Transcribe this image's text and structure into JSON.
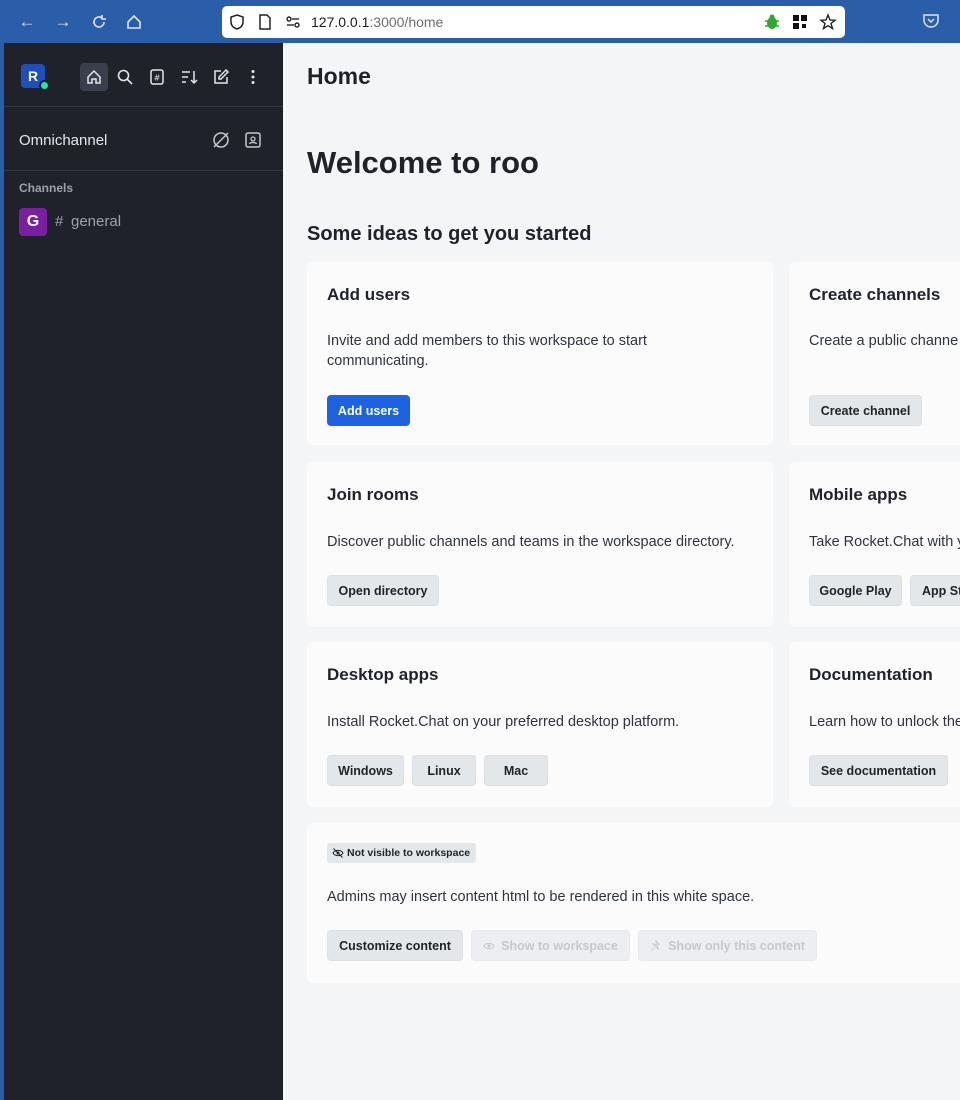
{
  "browser": {
    "url_host": "127.0.0.1",
    "url_path": ":3000/home"
  },
  "sidebar": {
    "avatar_initial": "R",
    "omnichannel_label": "Omnichannel",
    "channels_heading": "Channels",
    "channels": [
      {
        "initial": "G",
        "hash": "#",
        "name": "general"
      }
    ]
  },
  "main": {
    "page_title": "Home",
    "welcome": "Welcome to roo",
    "subheading": "Some ideas to get you started",
    "cards": {
      "add_users": {
        "title": "Add users",
        "text": "Invite and add members to this workspace to start communicating.",
        "button": "Add users"
      },
      "create_channels": {
        "title": "Create channels",
        "text": "Create a public channe",
        "button": "Create channel"
      },
      "join_rooms": {
        "title": "Join rooms",
        "text": "Discover public channels and teams in the workspace directory.",
        "button": "Open directory"
      },
      "mobile_apps": {
        "title": "Mobile apps",
        "text": "Take Rocket.Chat with y",
        "buttons": [
          "Google Play",
          "App St"
        ]
      },
      "desktop_apps": {
        "title": "Desktop apps",
        "text": "Install Rocket.Chat on your preferred desktop platform.",
        "buttons": [
          "Windows",
          "Linux",
          "Mac"
        ]
      },
      "documentation": {
        "title": "Documentation",
        "text": "Learn how to unlock the",
        "button": "See documentation"
      },
      "custom_content": {
        "badge": "Not visible to workspace",
        "text": "Admins may insert content html to be rendered in this white space.",
        "buttons": [
          "Customize content",
          "Show to workspace",
          "Show only this content"
        ]
      }
    }
  },
  "colors": {
    "browser_bar": "#2b5ea8",
    "sidebar": "#1f2329",
    "primary": "#1d62e0",
    "channel_avatar": "#7b1fa2",
    "online": "#2de0a5"
  }
}
